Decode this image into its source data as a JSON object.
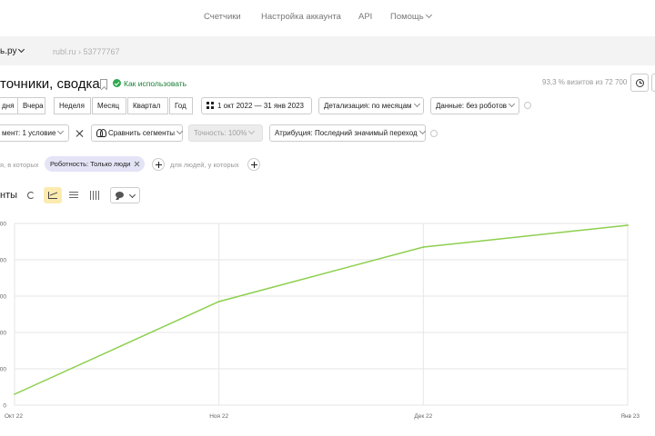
{
  "topnav": {
    "items": [
      {
        "label": "Счетчики"
      },
      {
        "label": "Настройка аккаунта"
      },
      {
        "label": "API"
      },
      {
        "label": "Помощь"
      }
    ]
  },
  "counter": {
    "site": "ь.ру",
    "breadcrumb": "rubl.ru › 53777767"
  },
  "report": {
    "title": "точники, сводка",
    "howto": "Как использовать",
    "visits_note": "93,3 % визитов из 72 700"
  },
  "periods": [
    "дня",
    "Вчера",
    "Неделя",
    "Месяц",
    "Квартал",
    "Год"
  ],
  "date_range": "1 окт 2022 — 31 янв 2023",
  "detail": "Детализация: по месяцам",
  "data_filter": "Данные: без роботов",
  "segment": "мент: 1 условие",
  "compare": "Сравнить сегменты",
  "accuracy": "Точность: 100%",
  "attribution": "Атрибуция: Последний значимый переход",
  "segment_row": {
    "left_text": "я, в которых",
    "chip": "Роботность: Только люди",
    "right_text": "для людей, у которых"
  },
  "chart_section": {
    "title": "нты"
  },
  "colors": {
    "line": "#8ccf4d",
    "accent_active": "#fcebb0",
    "chip_bg": "#e4e4f7",
    "howto_green": "#2fa84f"
  },
  "icons": [
    "chevron-down-icon",
    "bookmark-icon",
    "check-circle-icon",
    "clock-icon",
    "calendar-icon",
    "close-icon",
    "compare-icon",
    "info-icon",
    "plus-icon",
    "pie-icon",
    "line-chart-icon",
    "bar-rows-icon",
    "columns-icon",
    "comment-icon"
  ],
  "chart_data": {
    "type": "line",
    "categories": [
      "Окт 22",
      "Ноя 22",
      "Дек 22",
      "Янв 23"
    ],
    "series": [
      {
        "values": [
          0.3,
          2.85,
          4.35,
          4.95
        ]
      }
    ],
    "y_tick_labels": [
      "00",
      "00",
      "00",
      "00",
      "00",
      "0"
    ],
    "ylim": [
      0,
      5
    ],
    "grid": true
  }
}
